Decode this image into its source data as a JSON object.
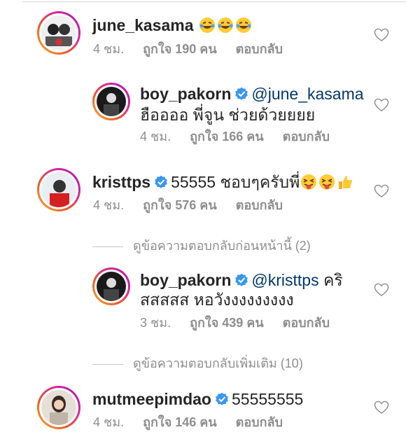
{
  "comments": [
    {
      "username": "june_kasama",
      "text": "",
      "emoji": [
        "grinning-tears",
        "grinning-tears",
        "grinning-tears"
      ],
      "time": "4 ชม.",
      "likes": "ถูกใจ 190 คน",
      "reply": "ตอบกลับ"
    },
    {
      "username": "boy_pakorn",
      "mention": "@june_kasama",
      "text": "ฮืออออ พี่จูน ช่วยด้วยยยย",
      "time": "4 ชม.",
      "likes": "ถูกใจ 166 คน",
      "reply": "ตอบกลับ"
    },
    {
      "username": "kristtps",
      "text": "55555 ชอบๆครับพี่",
      "emoji": [
        "tongue-wink",
        "tongue-wink",
        "thumbs-up"
      ],
      "time": "4 ชม.",
      "likes": "ถูกใจ 576 คน",
      "reply": "ตอบกลับ"
    },
    {
      "username": "boy_pakorn",
      "mention": "@kristtps",
      "text_after": "คริ",
      "text": "สสสสส หอวังงงงงงงงง",
      "time": "3 ชม.",
      "likes": "ถูกใจ 439 คน",
      "reply": "ตอบกลับ"
    },
    {
      "username": "mutmeepimdao",
      "text": "55555555",
      "time": "4 ชม.",
      "likes": "ถูกใจ 146 คน",
      "reply": "ตอบกลับ"
    }
  ],
  "view_previous": "ดูข้อความตอบกลับก่อนหน้านี้ (2)",
  "view_more": "ดูข้อความตอบกลับเพิ่มเติม (10)",
  "colors": {
    "mention": "#00376b",
    "verified": "#3897f0",
    "meta": "#8e8e8e"
  }
}
